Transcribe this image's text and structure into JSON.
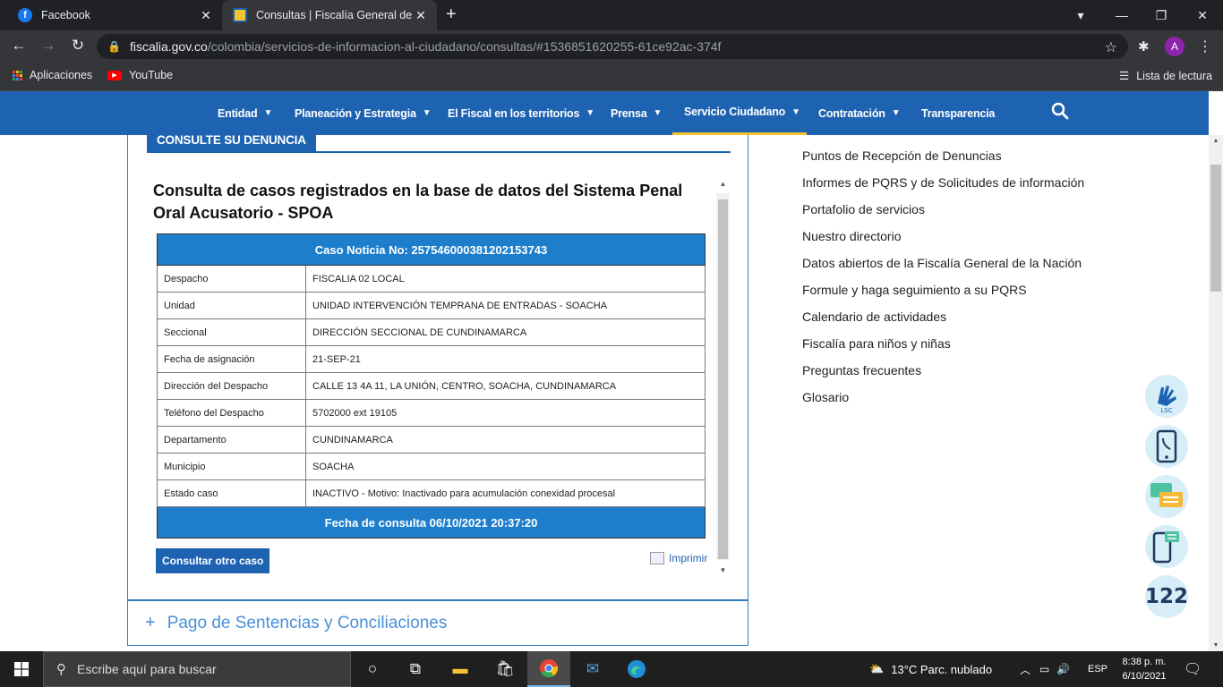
{
  "browser": {
    "tabs": [
      {
        "title": "Facebook",
        "icon": "facebook-icon"
      },
      {
        "title": "Consultas | Fiscalía General de la",
        "icon": "fiscalia-icon"
      }
    ],
    "url_host": "fiscalia.gov.co",
    "url_path": "/colombia/servicios-de-informacion-al-ciudadano/consultas/#1536851620255-61ce92ac-374f",
    "avatar_letter": "A",
    "bookmarks": {
      "apps": "Aplicaciones",
      "youtube": "YouTube",
      "reading_list": "Lista de lectura"
    }
  },
  "site_nav": {
    "items": [
      {
        "label": "Entidad",
        "has_menu": true
      },
      {
        "label": "Planeación y Estrategia",
        "has_menu": true
      },
      {
        "label": "El Fiscal en los territorios",
        "has_menu": true
      },
      {
        "label": "Prensa",
        "has_menu": true
      },
      {
        "label": "Servicio Ciudadano",
        "has_menu": true,
        "active": true
      },
      {
        "label": "Contratación",
        "has_menu": true
      },
      {
        "label": "Transparencia",
        "has_menu": false
      }
    ]
  },
  "main": {
    "tab_label": "CONSULTE SU DENUNCIA",
    "title": "Consulta de casos registrados en la base de datos del Sistema Penal Oral Acusatorio - SPOA",
    "case_header": "Caso Noticia No: 257546000381202153743",
    "rows": [
      {
        "key": "Despacho",
        "value": "FISCALIA 02 LOCAL"
      },
      {
        "key": "Unidad",
        "value": "UNIDAD INTERVENCIÓN TEMPRANA DE ENTRADAS - SOACHA"
      },
      {
        "key": "Seccional",
        "value": "DIRECCIÓN SECCIONAL DE CUNDINAMARCA"
      },
      {
        "key": "Fecha de asignación",
        "value": "21-SEP-21"
      },
      {
        "key": "Dirección del Despacho",
        "value": "CALLE 13 4A 11, LA UNIÓN, CENTRO, SOACHA, CUNDINAMARCA"
      },
      {
        "key": "Teléfono del Despacho",
        "value": "5702000 ext 19105"
      },
      {
        "key": "Departamento",
        "value": "CUNDINAMARCA"
      },
      {
        "key": "Municipio",
        "value": "SOACHA"
      },
      {
        "key": "Estado caso",
        "value": "INACTIVO - Motivo: Inactivado para acumulación conexidad procesal"
      }
    ],
    "footer": "Fecha de consulta 06/10/2021 20:37:20",
    "consult_button": "Consultar otro caso",
    "print_link": "Imprimir",
    "accordion_label": "Pago de Sentencias y Conciliaciones"
  },
  "sidebar": {
    "links": [
      "Puntos de Recepción de Denuncias",
      "Informes de PQRS y de Solicitudes de información",
      "Portafolio de servicios",
      "Nuestro directorio",
      "Datos abiertos de la Fiscalía General de la Nación",
      "Formule y haga seguimiento a su PQRS",
      "Calendario de actividades",
      "Fiscalía para niños y niñas",
      "Preguntas frecuentes",
      "Glosario"
    ],
    "floating_buttons": [
      {
        "icon": "sign-language-icon",
        "label": "LSC"
      },
      {
        "icon": "phone-icon",
        "label": ""
      },
      {
        "icon": "chat-icon",
        "label": ""
      },
      {
        "icon": "mobile-chat-icon",
        "label": ""
      },
      {
        "icon": "line-122-icon",
        "label": "122"
      }
    ]
  },
  "taskbar": {
    "search_placeholder": "Escribe aquí para buscar",
    "weather": "13°C  Parc. nublado",
    "lang": "ESP",
    "time": "8:38 p. m.",
    "date": "6/10/2021"
  },
  "colors": {
    "brand_blue": "#1e63b1",
    "table_blue": "#1e7ecb",
    "active_underline": "#f4c430"
  }
}
